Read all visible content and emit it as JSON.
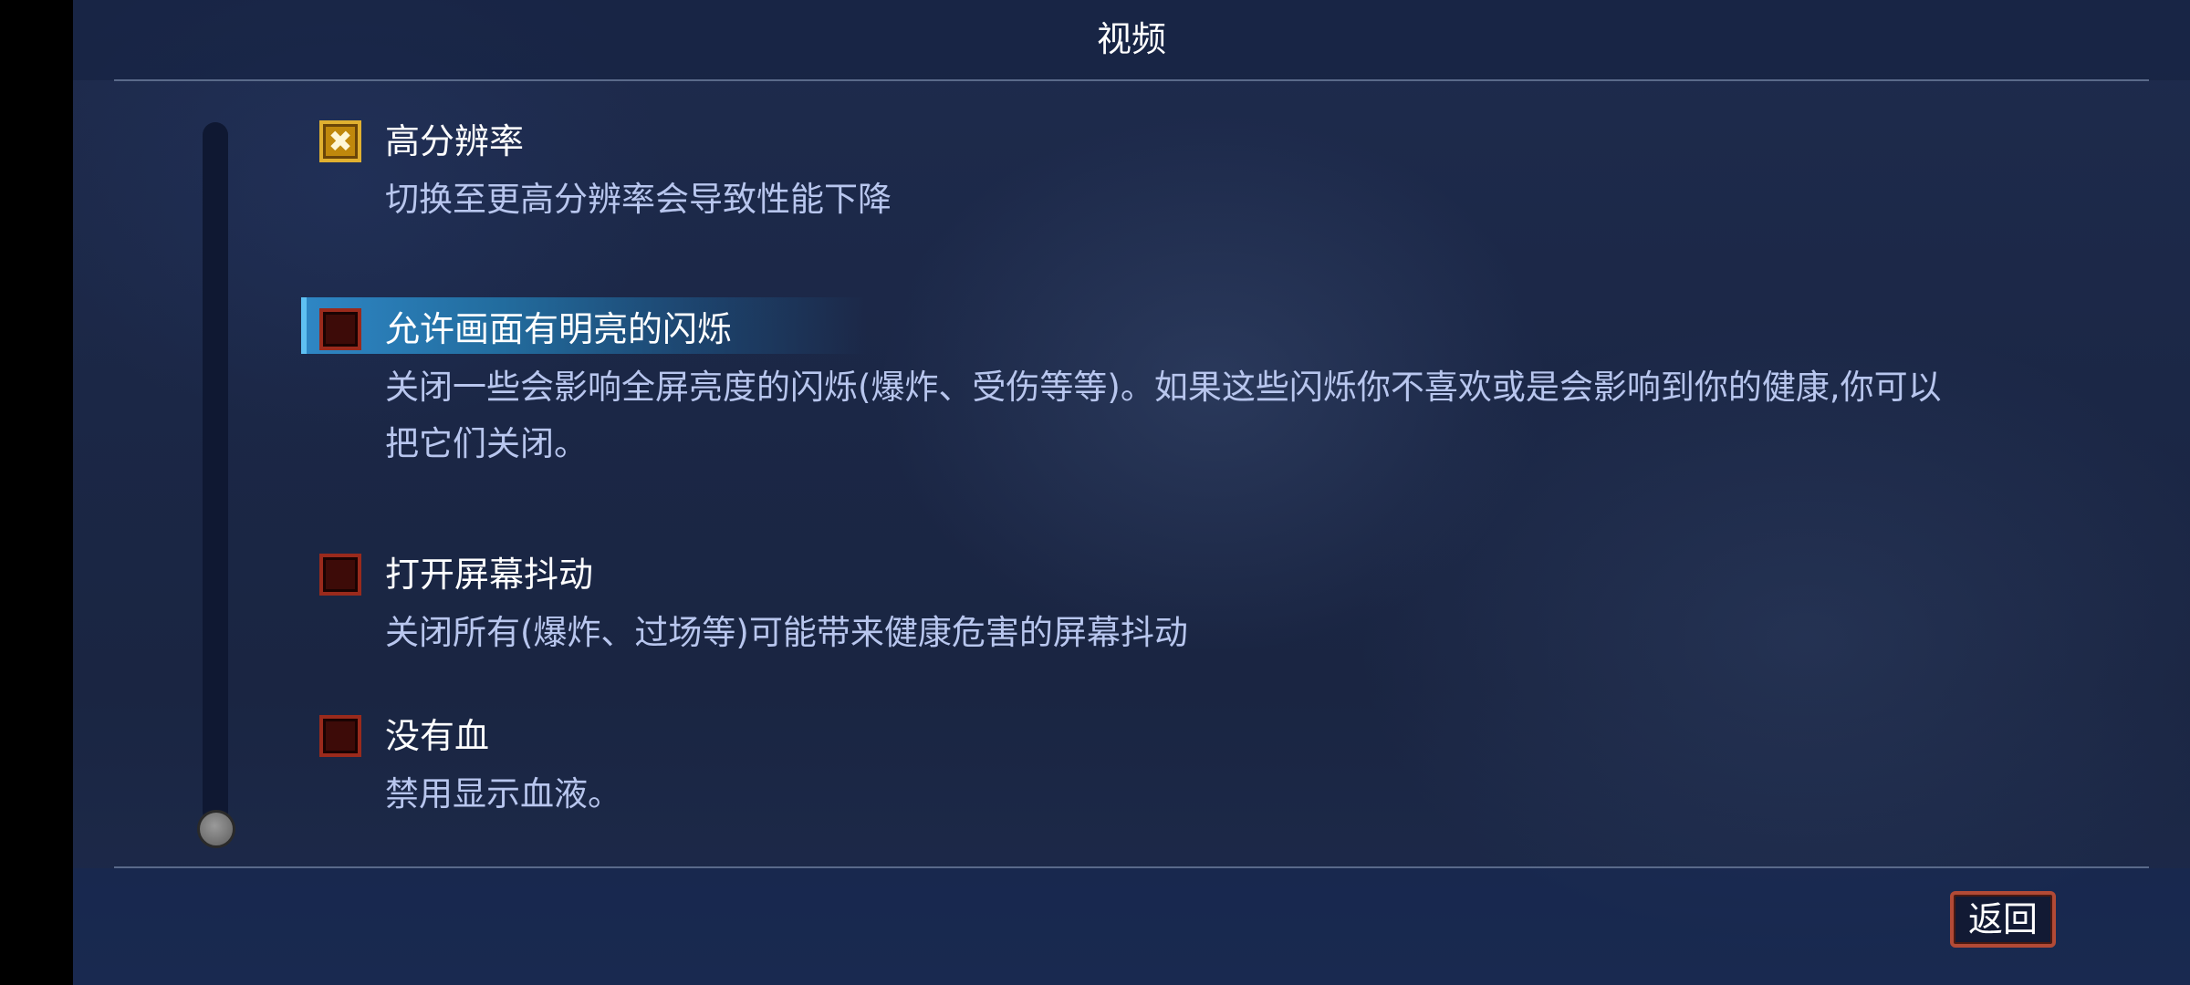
{
  "header": {
    "title": "视频"
  },
  "options": [
    {
      "title": "高分辨率",
      "description": "切换至更高分辨率会导致性能下降",
      "checked": true,
      "selected": false
    },
    {
      "title": "允许画面有明亮的闪烁",
      "description": "关闭一些会影响全屏亮度的闪烁(爆炸、受伤等等)。如果这些闪烁你不喜欢或是会影响到你的健康,你可以把它们关闭。",
      "checked": false,
      "selected": true
    },
    {
      "title": "打开屏幕抖动",
      "description": "关闭所有(爆炸、过场等)可能带来健康危害的屏幕抖动",
      "checked": false,
      "selected": false
    },
    {
      "title": "没有血",
      "description": "禁用显示血液。",
      "checked": false,
      "selected": false
    }
  ],
  "footer": {
    "back_label": "返回"
  },
  "icons": {
    "checked_mark": "✖"
  },
  "colors": {
    "checkbox_checked": "#c0880c",
    "checkbox_unchecked": "#3d0b08",
    "highlight": "#2e86c4",
    "description_text": "#b8c6ee"
  }
}
